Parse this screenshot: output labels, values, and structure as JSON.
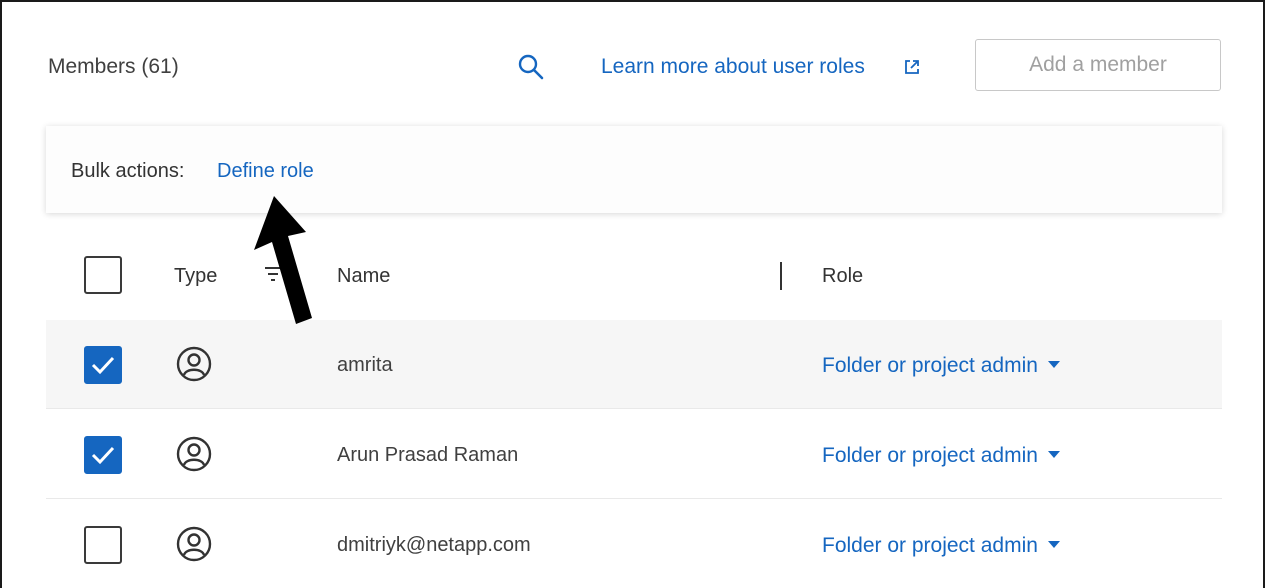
{
  "header": {
    "members_title": "Members (61)",
    "learn_link": "Learn more about user roles",
    "add_member_button": "Add a member",
    "icons": [
      "search-icon",
      "external-link-icon"
    ]
  },
  "bulk_actions": {
    "label": "Bulk actions:",
    "define_role": "Define role"
  },
  "table": {
    "columns": [
      "Type",
      "Name",
      "Role"
    ],
    "header_checked": false,
    "rows": [
      {
        "checked": true,
        "type_icon": "user-circle-icon",
        "name": "amrita",
        "role": "Folder or project admin"
      },
      {
        "checked": true,
        "type_icon": "user-circle-icon",
        "name": "Arun Prasad Raman",
        "role": "Folder or project admin"
      },
      {
        "checked": false,
        "type_icon": "user-circle-icon",
        "name": "dmitriyk@netapp.com",
        "role": "Folder or project admin"
      }
    ]
  },
  "colors": {
    "accent": "#1566c0",
    "row_shade": "#f6f6f6",
    "text": "#333333",
    "annotation_arrow": "#000000"
  }
}
